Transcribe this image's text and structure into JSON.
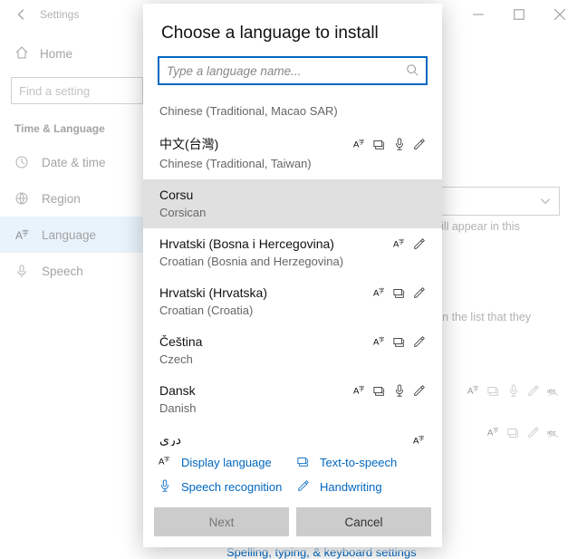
{
  "bg": {
    "title": "Settings",
    "home": "Home",
    "search_placeholder": "Find a setting",
    "section": "Time & Language",
    "nav": [
      {
        "label": "Date & time"
      },
      {
        "label": "Region"
      },
      {
        "label": "Language"
      },
      {
        "label": "Speech"
      }
    ],
    "hint1": "will appear in this",
    "hint2": "ge in the list that they",
    "link": "Spelling, typing, & keyboard settings"
  },
  "dialog": {
    "title": "Choose a language to install",
    "search_placeholder": "Type a language name...",
    "langs": [
      {
        "native": "",
        "english": "Chinese (Traditional, Macao SAR)",
        "feats": [],
        "single": true
      },
      {
        "native": "中文(台灣)",
        "english": "Chinese (Traditional, Taiwan)",
        "feats": [
          "display",
          "tts",
          "speech",
          "handwriting"
        ]
      },
      {
        "native": "Corsu",
        "english": "Corsican",
        "feats": [],
        "selected": true
      },
      {
        "native": "Hrvatski (Bosna i Hercegovina)",
        "english": "Croatian (Bosnia and Herzegovina)",
        "feats": [
          "display",
          "handwriting"
        ]
      },
      {
        "native": "Hrvatski (Hrvatska)",
        "english": "Croatian (Croatia)",
        "feats": [
          "display",
          "tts",
          "handwriting"
        ]
      },
      {
        "native": "Čeština",
        "english": "Czech",
        "feats": [
          "display",
          "tts",
          "handwriting"
        ]
      },
      {
        "native": "Dansk",
        "english": "Danish",
        "feats": [
          "display",
          "tts",
          "speech",
          "handwriting"
        ]
      },
      {
        "native": "درى",
        "english": "",
        "feats": [
          "display"
        ]
      }
    ],
    "legend": {
      "display": "Display language",
      "tts": "Text-to-speech",
      "speech": "Speech recognition",
      "handwriting": "Handwriting"
    },
    "buttons": {
      "next": "Next",
      "cancel": "Cancel"
    }
  }
}
